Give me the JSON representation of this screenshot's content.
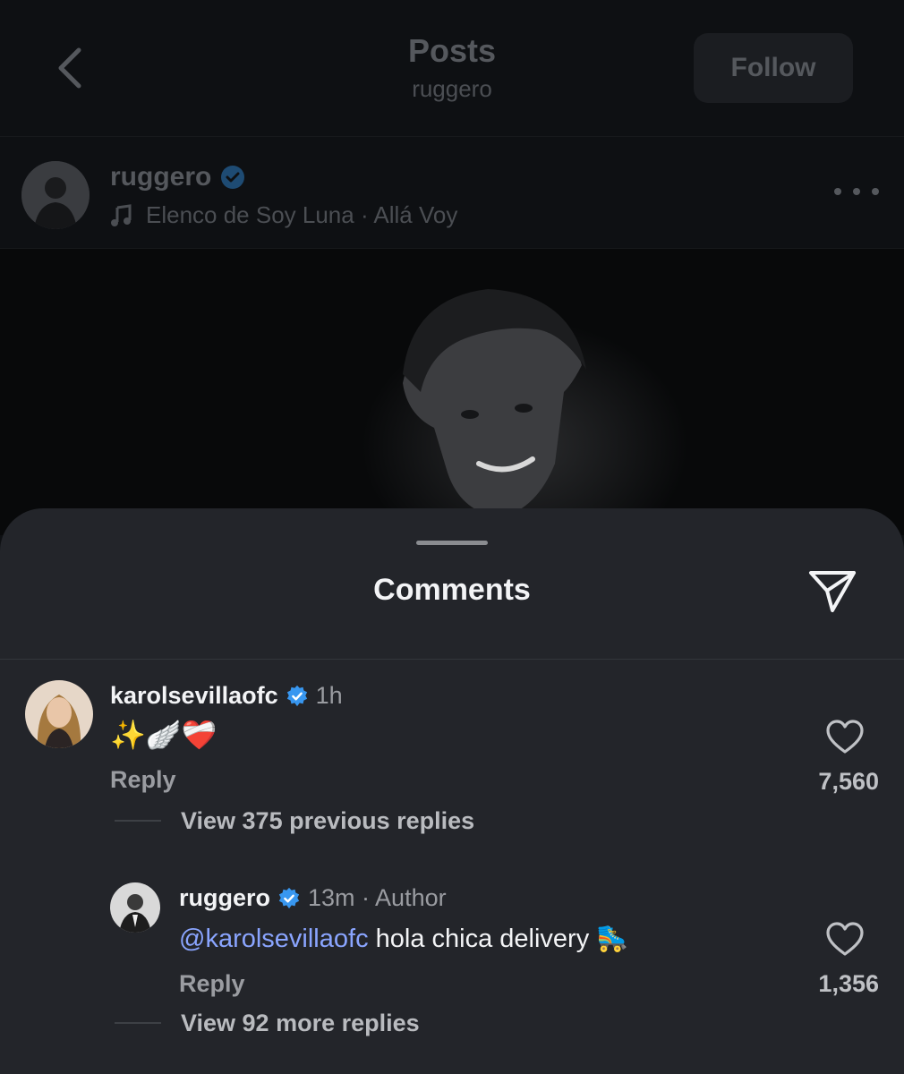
{
  "nav": {
    "title": "Posts",
    "subtitle": "ruggero",
    "follow_label": "Follow"
  },
  "post": {
    "username": "ruggero",
    "music": "Elenco de Soy Luna · Allá Voy"
  },
  "sheet": {
    "title": "Comments"
  },
  "comments": [
    {
      "username": "karolsevillaofc",
      "time": "1h",
      "text": "✨🪽❤️‍🩹",
      "reply_label": "Reply",
      "likes": "7,560",
      "view_replies": "View 375 previous replies"
    },
    {
      "username": "ruggero",
      "time": "13m · Author",
      "mention": "@karolsevillaofc",
      "text": "hola chica delivery 🛼",
      "reply_label": "Reply",
      "likes": "1,356",
      "view_replies": "View 92 more replies"
    }
  ],
  "colors": {
    "verified": "#3897f0",
    "mention": "#8aa5ff",
    "sheet_bg": "#23252a"
  },
  "icons": [
    "chevron-left-icon",
    "verified-badge-icon",
    "music-note-icon",
    "more-icon",
    "send-icon",
    "heart-icon"
  ]
}
